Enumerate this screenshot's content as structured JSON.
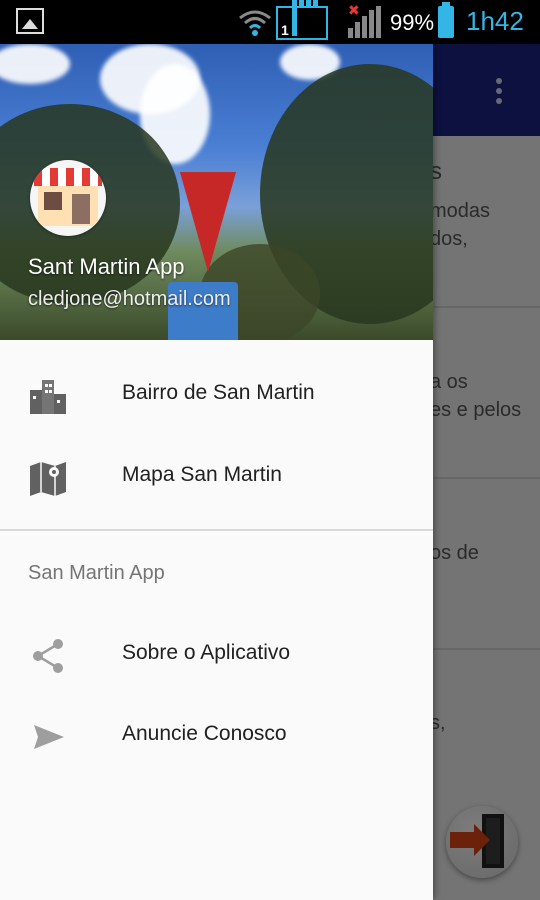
{
  "status_bar": {
    "signal_sim": "1",
    "battery_percent": "99%",
    "time": "1h42",
    "accent": "#33b5e5"
  },
  "background_app": {
    "toolbar_color": "#1a237e",
    "visible_text": [
      "s",
      "modas",
      "dos,",
      "a os",
      "es e pelos",
      "os de",
      "s,"
    ]
  },
  "drawer": {
    "header": {
      "name": "Sant Martin App",
      "email": "cledjone@hotmail.com",
      "avatar_icon": "storefront-icon"
    },
    "items": [
      {
        "label": "Bairro de San Martin",
        "icon": "buildings-icon"
      },
      {
        "label": "Mapa San Martin",
        "icon": "map-icon"
      }
    ],
    "section_title": "San Martin App",
    "section_items": [
      {
        "label": "Sobre o Aplicativo",
        "icon": "share-icon"
      },
      {
        "label": "Anuncie Conosco",
        "icon": "send-icon"
      }
    ]
  },
  "fab": {
    "icon": "exit-door-icon"
  }
}
